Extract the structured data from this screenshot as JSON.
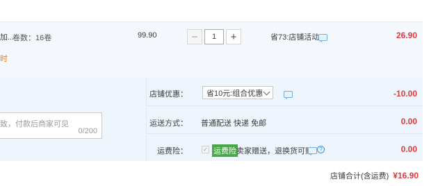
{
  "item": {
    "title_fragment": "加...",
    "spec": "卷数：16卷",
    "sub_note": "时",
    "unit_price": "99.90",
    "quantity": "1",
    "promo": "省73:店铺活动",
    "subtotal": "26.90"
  },
  "message": {
    "placeholder": "致，付款后商家可见",
    "count": "0/200"
  },
  "shop_discount": {
    "label": "店铺优惠：",
    "selected": "省10元:组合优惠",
    "amount": "-10.00"
  },
  "shipping": {
    "label": "运送方式：",
    "value": "普通配送 快递 免邮",
    "amount": "0.00"
  },
  "insurance": {
    "label": "运费险：",
    "badge": "运费险",
    "text": "卖家赠送，退换货可赔",
    "amount": "0.00"
  },
  "total": {
    "label": "店铺合计(含运费)",
    "amount": "¥16.90"
  },
  "icons": [
    "minus-icon",
    "plus-icon",
    "chat-icon",
    "chevron-down-icon",
    "checkbox-icon",
    "question-icon"
  ],
  "colors": {
    "price_red": "#e4393c",
    "row_bg": "#f4f8fd",
    "badge_green": "#47a847",
    "note_orange": "#f07a1c"
  }
}
